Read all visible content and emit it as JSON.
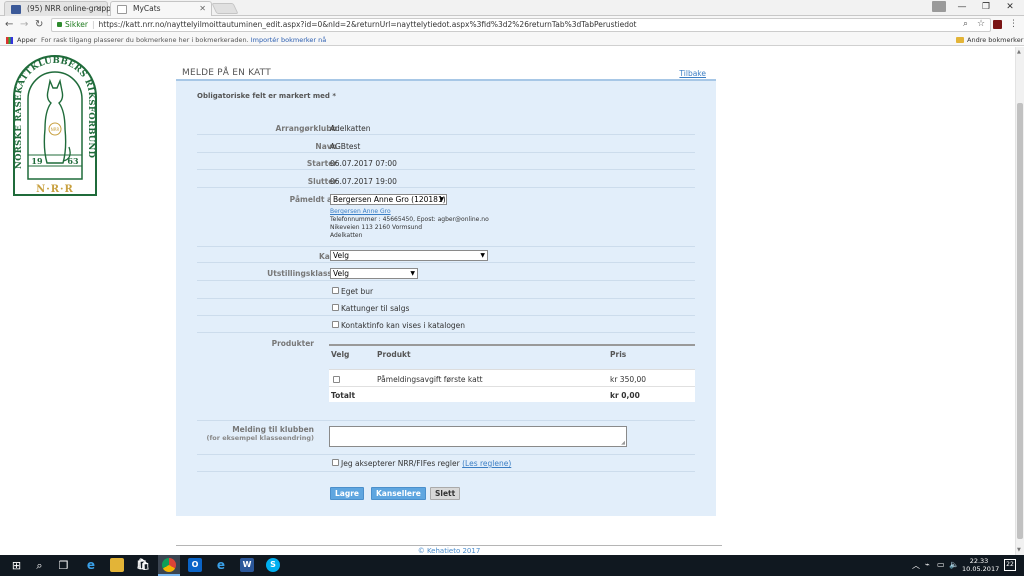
{
  "browser": {
    "tabs": [
      {
        "title": "(95) NRR online-gruppe",
        "favicon_color": "#3b5998"
      },
      {
        "title": "MyCats",
        "favicon_color": "#ffffff"
      }
    ],
    "omnibox": {
      "security_label": "Sikker",
      "url": "https://katt.nrr.no/nayttelyilmoittautuminen_edit.aspx?id=0&nId=2&returnUrl=nayttelytiedot.aspx%3fid%3d2%26returnTab%3dTabPerustiedot"
    },
    "bookmarks": {
      "apps_label": "Apper",
      "hint": "For rask tilgang plasserer du bokmerkene her i bokmerkeraden.",
      "import_link": "Importér bokmerker nå",
      "other_label": "Andre bokmerker"
    }
  },
  "page": {
    "title": "MELDE PÅ EN KATT",
    "back_link": "Tilbake",
    "required_note": "Obligatoriske felt er markert med *",
    "fields": {
      "arranger_label": "Arrangørklubb",
      "arranger_value": "Adelkatten",
      "name_label": "Navn",
      "name_value": "AGBtest",
      "start_label": "Starter",
      "start_value": "06.07.2017 07:00",
      "end_label": "Slutter",
      "end_value": "06.07.2017 19:00",
      "signed_up_by_label": "Påmeldt av",
      "signed_up_by_value": "Bergersen Anne Gro (120181)",
      "owner_name": "Bergersen Anne Gro",
      "owner_contact": "Telefonnummer : 45665450, Epost: agber@online.no",
      "owner_address": "Nikeveien 113 2160 Vormsund",
      "owner_club": "Adelkatten",
      "cat_label": "Katt",
      "cat_value": "Velg",
      "class_label": "Utstillingsklasse",
      "class_value": "Velg"
    },
    "checkboxes": {
      "own_cage": "Eget bur",
      "kittens_for_sale": "Kattunger til salgs",
      "contact_in_catalog": "Kontaktinfo kan vises i katalogen"
    },
    "products": {
      "label": "Produkter",
      "headers": {
        "select": "Velg",
        "product": "Produkt",
        "price": "Pris"
      },
      "rows": [
        {
          "name": "Påmeldingsavgift første katt",
          "price": "kr 350,00"
        }
      ],
      "total_label": "Totalt",
      "total_value": "kr 0,00"
    },
    "message": {
      "label": "Melding til klubben",
      "sublabel": "(for eksempel klasseendring)",
      "value": ""
    },
    "accept": {
      "label": "Jeg aksepterer NRR/FIFes regler",
      "link": "(Les reglene)"
    },
    "buttons": {
      "save": "Lagre",
      "cancel": "Kansellere",
      "delete": "Slett"
    },
    "footer": "© Kehatieto 2017"
  },
  "logo": {
    "text_ring": "NORSKE RASEKATTKLUBBERS RIKSFORBUND",
    "year_left": "19",
    "year_right": "63",
    "abbr": "N·R·R",
    "badge_letters": "NRR",
    "color": "#1f6b3a"
  },
  "taskbar": {
    "time": "22.33",
    "date": "10.05.2017",
    "notifications": "22"
  }
}
